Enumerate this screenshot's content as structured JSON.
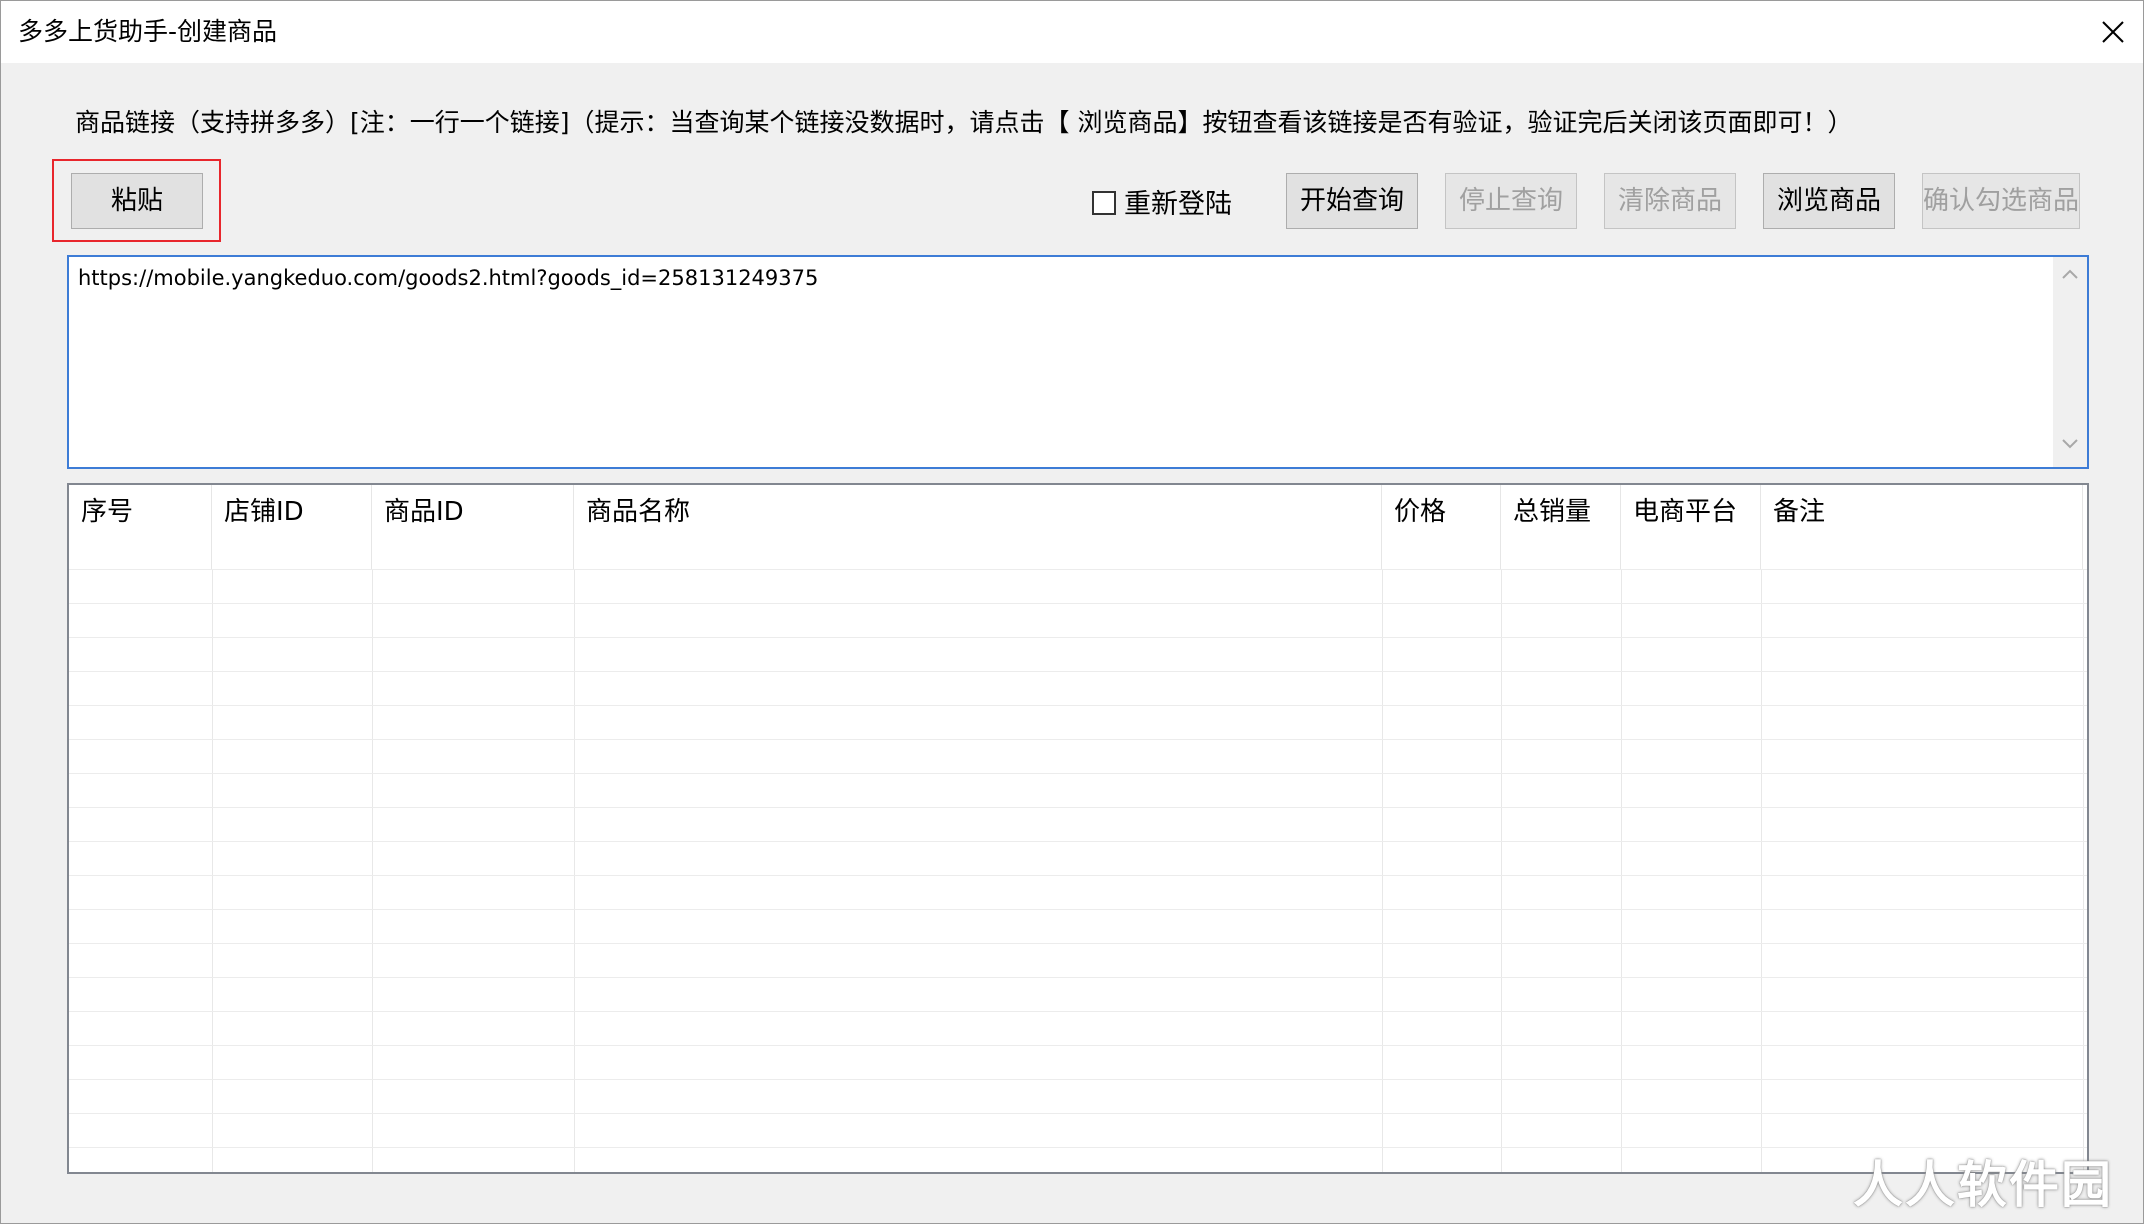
{
  "window": {
    "title": "多多上货助手-创建商品",
    "close_icon": "close-icon"
  },
  "hint": "商品链接（支持拼多多）[注：一行一个链接]（提示：当查询某个链接没数据时，请点击【 浏览商品】按钮查看该链接是否有验证，验证完后关闭该页面即可！）",
  "toolbar": {
    "paste_label": "粘贴",
    "relogin_label": "重新登陆",
    "relogin_checked": false,
    "start_query_label": "开始查询",
    "stop_query_label": "停止查询",
    "clear_goods_label": "清除商品",
    "browse_goods_label": "浏览商品",
    "confirm_selected_label": "确认勾选商品"
  },
  "url_input": {
    "value": "https://mobile.yangkeduo.com/goods2.html?goods_id=258131249375"
  },
  "table": {
    "columns": [
      "序号",
      "店铺ID",
      "商品ID",
      "商品名称",
      "价格",
      "总销量",
      "电商平台",
      "备注"
    ],
    "rows": []
  },
  "watermark": "人人软件园",
  "colors": {
    "highlight": "#e8262c",
    "focus_border": "#3d7cd6"
  }
}
